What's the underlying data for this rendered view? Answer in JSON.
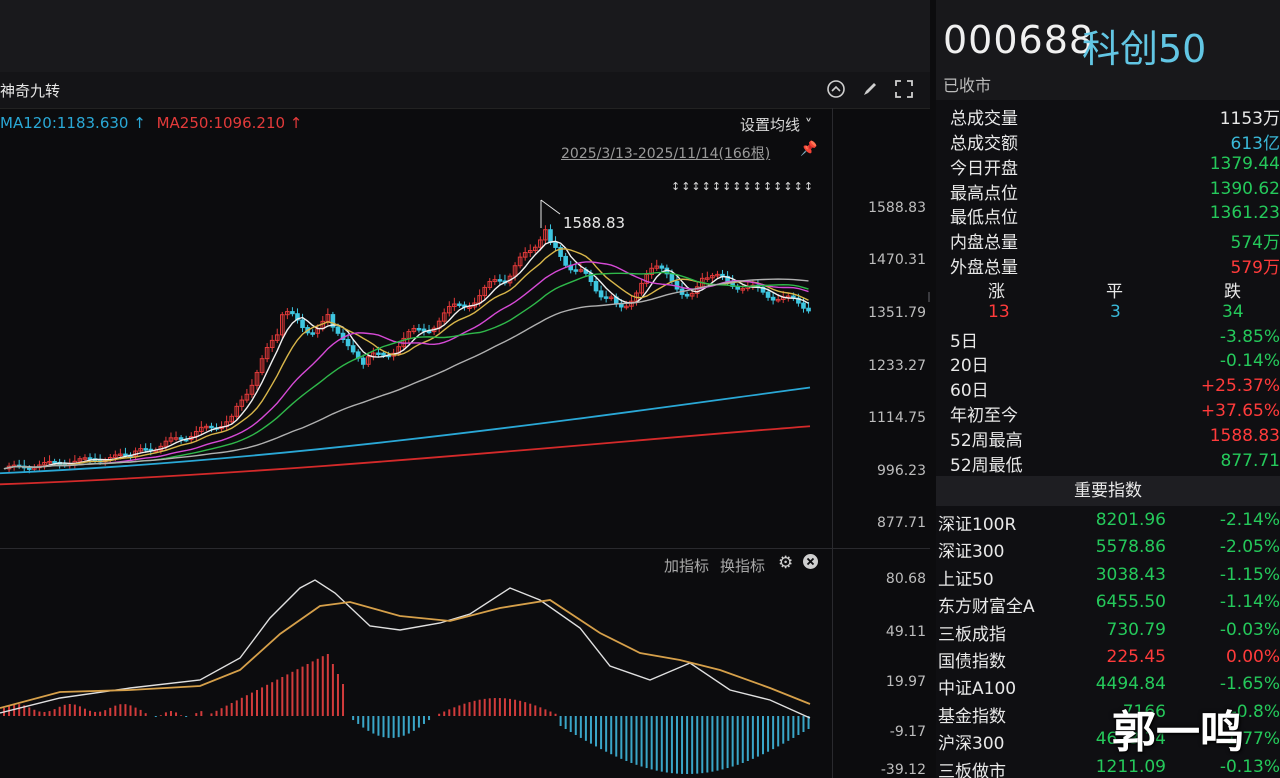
{
  "chart_header": {
    "indicator_name": "神奇九转",
    "ma120_label": "MA120:1183.630 ↑",
    "ma250_label": "MA250:1096.210 ↑",
    "settings_label": "设置均线 ˅",
    "date_range": "2025/3/13-2025/11/14(166根)",
    "arrows_row": "↕↕↕↕↕↕↕↕↕↕↕↕↕↕",
    "high_label": "1588.83",
    "icons": [
      "collapse-icon",
      "pen-icon",
      "fullscreen-icon",
      "pin-icon"
    ]
  },
  "price_axis": [
    "1588.83",
    "1470.31",
    "1351.79",
    "1233.27",
    "1114.75",
    "996.23",
    "877.71"
  ],
  "macd_axis": [
    "80.68",
    "49.11",
    "19.97",
    "-9.17",
    "-39.12"
  ],
  "sub_toolbar": {
    "add_indicator": "加指标",
    "switch_indicator": "换指标"
  },
  "quote": {
    "code": "000688",
    "name": "科创50",
    "status": "已收市",
    "stats": [
      {
        "label": "总成交量",
        "value": "1153万",
        "color": "white"
      },
      {
        "label": "总成交额",
        "value": "613亿",
        "color": "blue"
      },
      {
        "label": "今日开盘",
        "value": "1379.44",
        "color": "green"
      },
      {
        "label": "最高点位",
        "value": "1390.62",
        "color": "green"
      },
      {
        "label": "最低点位",
        "value": "1361.23",
        "color": "green"
      },
      {
        "label": "内盘总量",
        "value": "574万",
        "color": "green"
      },
      {
        "label": "外盘总量",
        "value": "579万",
        "color": "red"
      }
    ],
    "advance": {
      "up_label": "涨",
      "flat_label": "平",
      "down_label": "跌",
      "up": "13",
      "flat": "3",
      "down": "34"
    },
    "periods": [
      {
        "label": "5日",
        "value": "-3.85%",
        "color": "green"
      },
      {
        "label": "20日",
        "value": "-0.14%",
        "color": "green"
      },
      {
        "label": "60日",
        "value": "+25.37%",
        "color": "red"
      },
      {
        "label": "年初至今",
        "value": "+37.65%",
        "color": "red"
      },
      {
        "label": "52周最高",
        "value": "1588.83",
        "color": "red"
      },
      {
        "label": "52周最低",
        "value": "877.71",
        "color": "green"
      }
    ]
  },
  "indices_header": "重要指数",
  "indices": [
    {
      "name": "深证100R",
      "value": "8201.96",
      "change": "-2.14%",
      "vcolor": "green",
      "ccolor": "green"
    },
    {
      "name": "深证300",
      "value": "5578.86",
      "change": "-2.05%",
      "vcolor": "green",
      "ccolor": "green"
    },
    {
      "name": "上证50",
      "value": "3038.43",
      "change": "-1.15%",
      "vcolor": "green",
      "ccolor": "green"
    },
    {
      "name": "东方财富全A",
      "value": "6455.50",
      "change": "-1.14%",
      "vcolor": "green",
      "ccolor": "green"
    },
    {
      "name": "三板成指",
      "value": "730.79",
      "change": "-0.03%",
      "vcolor": "green",
      "ccolor": "green"
    },
    {
      "name": "国债指数",
      "value": "225.45",
      "change": "0.00%",
      "vcolor": "red",
      "ccolor": "red"
    },
    {
      "name": "中证A100",
      "value": "4494.84",
      "change": "-1.65%",
      "vcolor": "green",
      "ccolor": "green"
    },
    {
      "name": "基金指数",
      "value": "7166",
      "change": "-0.8%",
      "vcolor": "green",
      "ccolor": "green"
    },
    {
      "name": "沪深300",
      "value": "4628.14",
      "change": "-1.77%",
      "vcolor": "green",
      "ccolor": "green"
    },
    {
      "name": "三板做市",
      "value": "1211.09",
      "change": "-0.13%",
      "vcolor": "green",
      "ccolor": "green"
    }
  ],
  "watermark": "郭一鸣",
  "colors": {
    "up": "#e33a3a",
    "down": "#3ec6e0",
    "green": "#25c95b",
    "red": "#ff3b3b",
    "blue": "#3ab8d8"
  }
}
